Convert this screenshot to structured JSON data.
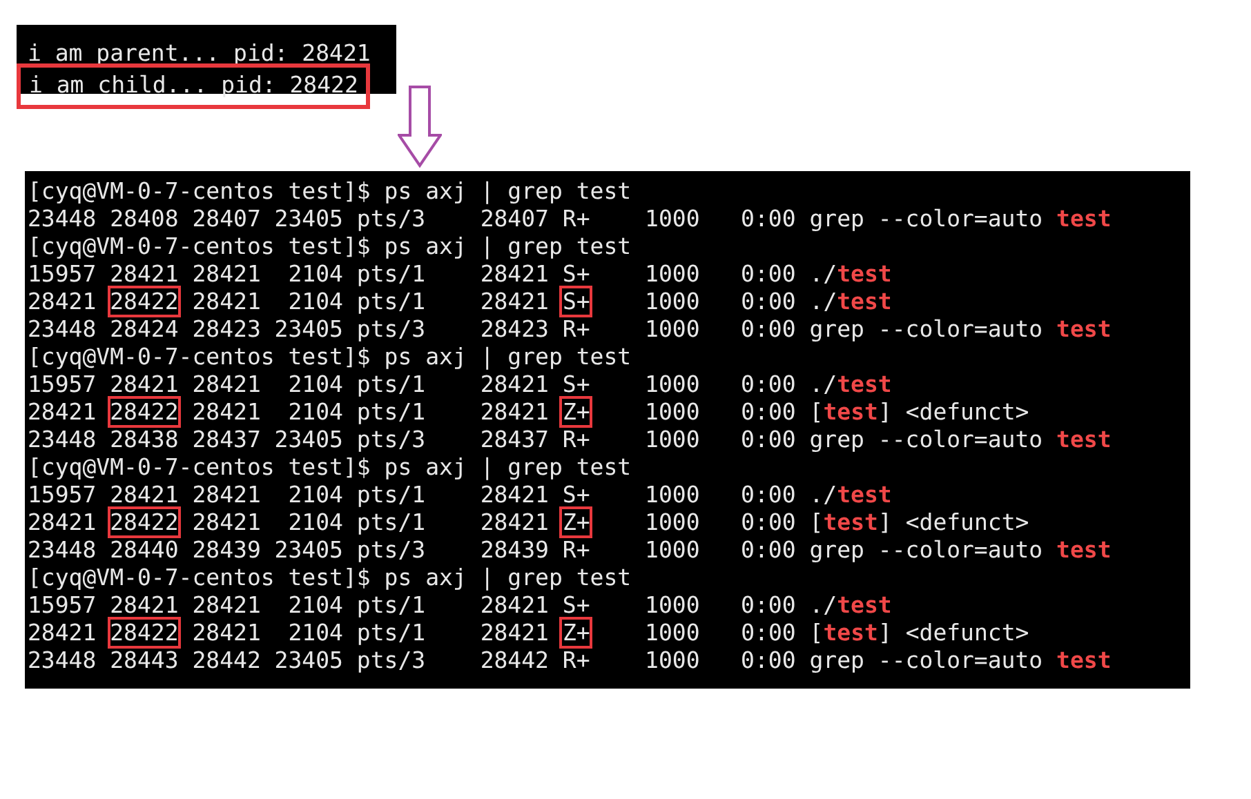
{
  "output_terminal": {
    "lines": [
      {
        "segments": [
          {
            "text": "i am parent... pid: 28421",
            "kind": "plain"
          }
        ]
      },
      {
        "segments": [
          {
            "text": "i am child... pid: 28422",
            "kind": "boxed"
          }
        ]
      }
    ]
  },
  "ps_terminal": {
    "lines": [
      {
        "segments": [
          {
            "text": "[cyq@VM-0-7-centos test]$ ps axj | grep test",
            "kind": "plain"
          }
        ]
      },
      {
        "segments": [
          {
            "text": "23448 28408 28407 23405 pts/3    28407 R+    1000   0:00 grep --color=auto ",
            "kind": "plain"
          },
          {
            "text": "test",
            "kind": "match"
          }
        ]
      },
      {
        "segments": [
          {
            "text": "[cyq@VM-0-7-centos test]$ ps axj | grep test",
            "kind": "plain"
          }
        ]
      },
      {
        "segments": [
          {
            "text": "15957 28421 28421  2104 pts/1    28421 S+    1000   0:00 ./",
            "kind": "plain"
          },
          {
            "text": "test",
            "kind": "match"
          }
        ]
      },
      {
        "segments": [
          {
            "text": "28421 ",
            "kind": "plain"
          },
          {
            "text": "28422",
            "kind": "boxed"
          },
          {
            "text": " 28421  2104 pts/1    28421 ",
            "kind": "plain"
          },
          {
            "text": "S+",
            "kind": "boxed"
          },
          {
            "text": "    1000   0:00 ./",
            "kind": "plain"
          },
          {
            "text": "test",
            "kind": "match"
          }
        ]
      },
      {
        "segments": [
          {
            "text": "23448 28424 28423 23405 pts/3    28423 R+    1000   0:00 grep --color=auto ",
            "kind": "plain"
          },
          {
            "text": "test",
            "kind": "match"
          }
        ]
      },
      {
        "segments": [
          {
            "text": "[cyq@VM-0-7-centos test]$ ps axj | grep test",
            "kind": "plain"
          }
        ]
      },
      {
        "segments": [
          {
            "text": "15957 28421 28421  2104 pts/1    28421 S+    1000   0:00 ./",
            "kind": "plain"
          },
          {
            "text": "test",
            "kind": "match"
          }
        ]
      },
      {
        "segments": [
          {
            "text": "28421 ",
            "kind": "plain"
          },
          {
            "text": "28422",
            "kind": "boxed"
          },
          {
            "text": " 28421  2104 pts/1    28421 ",
            "kind": "plain"
          },
          {
            "text": "Z+",
            "kind": "boxed"
          },
          {
            "text": "    1000   0:00 [",
            "kind": "plain"
          },
          {
            "text": "test",
            "kind": "match"
          },
          {
            "text": "] <defunct>",
            "kind": "plain"
          }
        ]
      },
      {
        "segments": [
          {
            "text": "23448 28438 28437 23405 pts/3    28437 R+    1000   0:00 grep --color=auto ",
            "kind": "plain"
          },
          {
            "text": "test",
            "kind": "match"
          }
        ]
      },
      {
        "segments": [
          {
            "text": "[cyq@VM-0-7-centos test]$ ps axj | grep test",
            "kind": "plain"
          }
        ]
      },
      {
        "segments": [
          {
            "text": "15957 28421 28421  2104 pts/1    28421 S+    1000   0:00 ./",
            "kind": "plain"
          },
          {
            "text": "test",
            "kind": "match"
          }
        ]
      },
      {
        "segments": [
          {
            "text": "28421 ",
            "kind": "plain"
          },
          {
            "text": "28422",
            "kind": "boxed"
          },
          {
            "text": " 28421  2104 pts/1    28421 ",
            "kind": "plain"
          },
          {
            "text": "Z+",
            "kind": "boxed"
          },
          {
            "text": "    1000   0:00 [",
            "kind": "plain"
          },
          {
            "text": "test",
            "kind": "match"
          },
          {
            "text": "] <defunct>",
            "kind": "plain"
          }
        ]
      },
      {
        "segments": [
          {
            "text": "23448 28440 28439 23405 pts/3    28439 R+    1000   0:00 grep --color=auto ",
            "kind": "plain"
          },
          {
            "text": "test",
            "kind": "match"
          }
        ]
      },
      {
        "segments": [
          {
            "text": "[cyq@VM-0-7-centos test]$ ps axj | grep test",
            "kind": "plain"
          }
        ]
      },
      {
        "segments": [
          {
            "text": "15957 28421 28421  2104 pts/1    28421 S+    1000   0:00 ./",
            "kind": "plain"
          },
          {
            "text": "test",
            "kind": "match"
          }
        ]
      },
      {
        "segments": [
          {
            "text": "28421 ",
            "kind": "plain"
          },
          {
            "text": "28422",
            "kind": "boxed"
          },
          {
            "text": " 28421  2104 pts/1    28421 ",
            "kind": "plain"
          },
          {
            "text": "Z+",
            "kind": "boxed"
          },
          {
            "text": "    1000   0:00 [",
            "kind": "plain"
          },
          {
            "text": "test",
            "kind": "match"
          },
          {
            "text": "] <defunct>",
            "kind": "plain"
          }
        ]
      },
      {
        "segments": [
          {
            "text": "23448 28443 28442 23405 pts/3    28442 R+    1000   0:00 grep --color=auto ",
            "kind": "plain"
          },
          {
            "text": "test",
            "kind": "match"
          }
        ]
      }
    ]
  }
}
